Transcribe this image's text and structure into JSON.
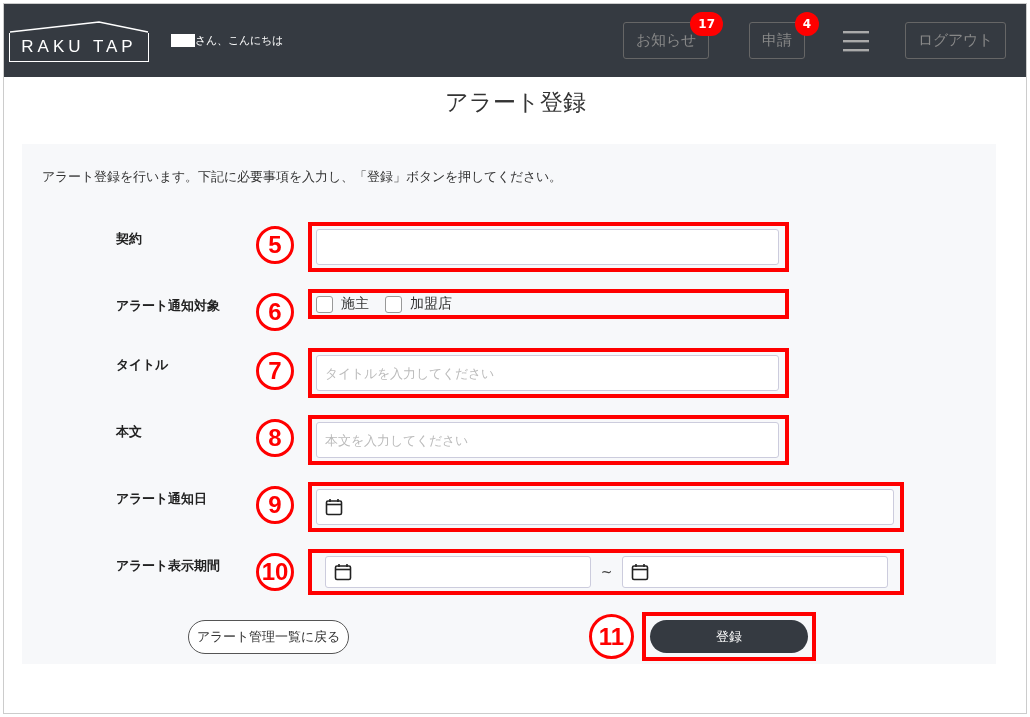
{
  "header": {
    "logo": "RAKU TAP",
    "greeting": "さん、こんにちは",
    "nav": [
      {
        "label": "お知らせ",
        "badge": "17"
      },
      {
        "label": "申請",
        "badge": "4"
      }
    ],
    "logout": "ログアウト"
  },
  "page_title": "アラート登録",
  "description": "アラート登録を行います。下記に必要事項を入力し、「登録」ボタンを押してください。",
  "fields": [
    {
      "kind": "text",
      "label": "契約",
      "marker": "5"
    },
    {
      "kind": "checkboxes",
      "label": "アラート通知対象",
      "marker": "6",
      "options": [
        {
          "label": "施主",
          "checked": false
        },
        {
          "label": "加盟店",
          "checked": false
        }
      ]
    },
    {
      "kind": "text",
      "label": "タイトル",
      "marker": "7",
      "placeholder": "タイトルを入力してください"
    },
    {
      "kind": "text",
      "label": "本文",
      "marker": "8",
      "placeholder": "本文を入力してください"
    },
    {
      "kind": "date",
      "label": "アラート通知日",
      "marker": "9"
    },
    {
      "kind": "daterange",
      "label": "アラート表示期間",
      "marker": "10",
      "separator": "~"
    }
  ],
  "back_button": "アラート管理一覧に戻る",
  "submit": {
    "label": "登録",
    "marker": "11"
  }
}
